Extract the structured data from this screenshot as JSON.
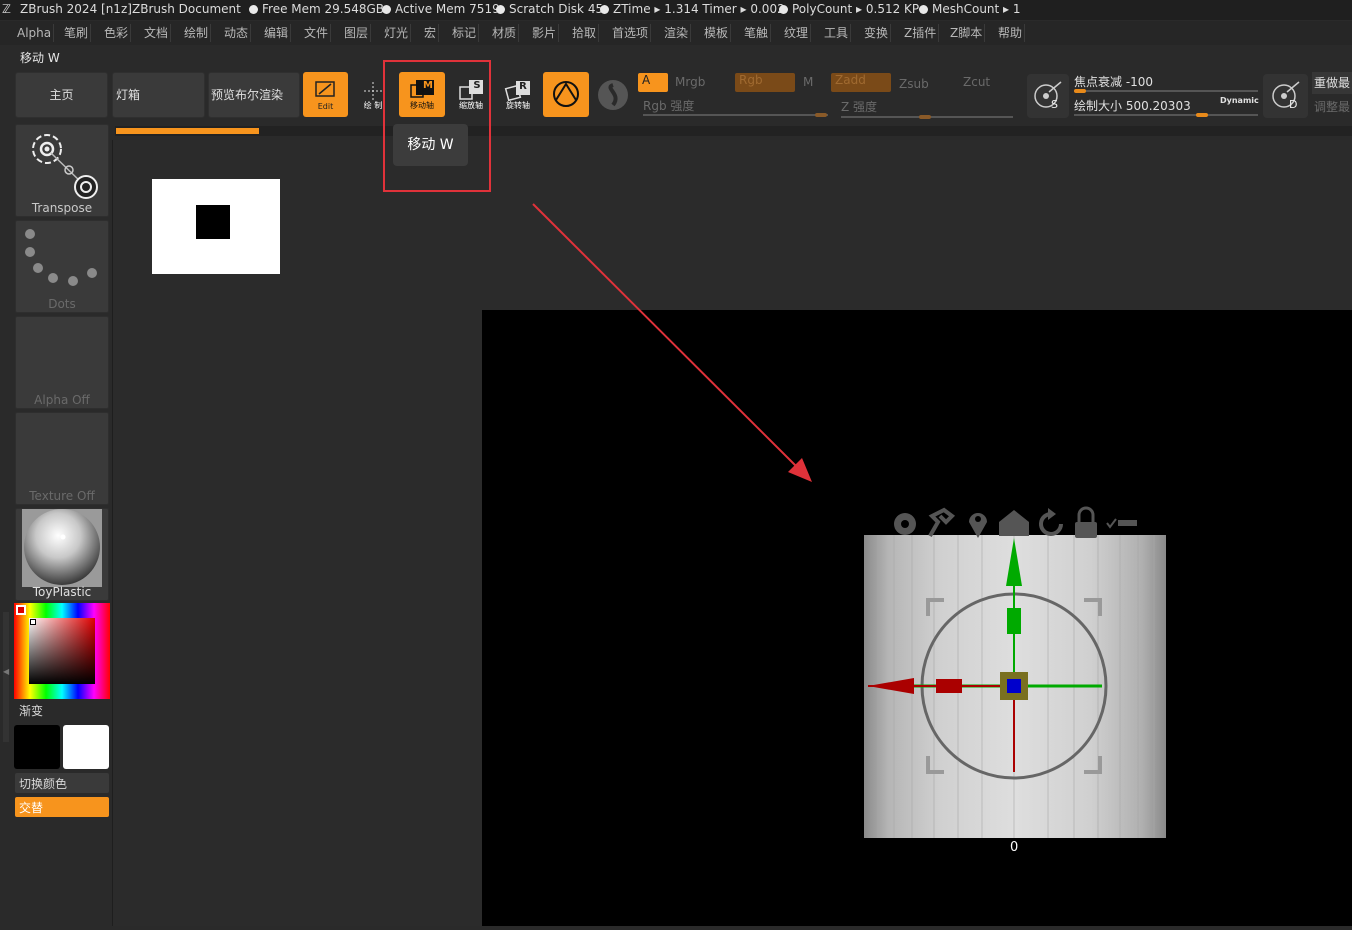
{
  "titlebar": {
    "app": "ZBrush 2024 [n1z]",
    "document": "ZBrush Document",
    "free_mem": "Free Mem 29.548GB",
    "active_mem": "Active Mem 7519",
    "scratch": "Scratch Disk 45",
    "ztime": "ZTime ▸ 1.314 Timer ▸ 0.002",
    "polycount": "PolyCount ▸ 0.512 KP",
    "meshcount": "MeshCount ▸ 1"
  },
  "menu": [
    "Alpha",
    "笔刷",
    "色彩",
    "文档",
    "绘制",
    "动态",
    "编辑",
    "文件",
    "图层",
    "灯光",
    "宏",
    "标记",
    "材质",
    "影片",
    "拾取",
    "首选项",
    "渲染",
    "模板",
    "笔触",
    "纹理",
    "工具",
    "变换",
    "Z插件",
    "Z脚本",
    "帮助"
  ],
  "subtitle": "移动 W",
  "toolbar": {
    "home": "主页",
    "lightbox": "灯箱",
    "preview": "预览布尔渲染",
    "edit": "Edit",
    "draw": "绘 制",
    "move": "移动轴",
    "scale": "缩放轴",
    "rotate": "旋转轴",
    "a": "A",
    "mrgb": "Mrgb",
    "rgb": "Rgb",
    "m": "M",
    "rgb_intensity": "Rgb 强度",
    "zadd": "Zadd",
    "zsub": "Zsub",
    "zcut": "Zcut",
    "z_intensity": "Z 强度",
    "focal_shift": "焦点衰减 -100",
    "draw_size": "绘制大小 500.20303",
    "dynamic": "Dynamic",
    "redo_last": "重做最",
    "adjust_last": "调整最",
    "move_key": "M",
    "scale_key": "S",
    "rotate_key": "R",
    "s_key": "S",
    "d_key": "D"
  },
  "tooltip": "移动 W",
  "left_panel": {
    "transpose": "Transpose",
    "dots": "Dots",
    "alpha_off": "Alpha Off",
    "texture_off": "Texture Off",
    "material": "ToyPlastic",
    "gradient": "渐变",
    "switch_color": "切换颜色",
    "alternate": "交替"
  },
  "viewport": {
    "counter": "0"
  },
  "colors": {
    "accent": "#f7941d",
    "annotation": "#e0323a"
  }
}
